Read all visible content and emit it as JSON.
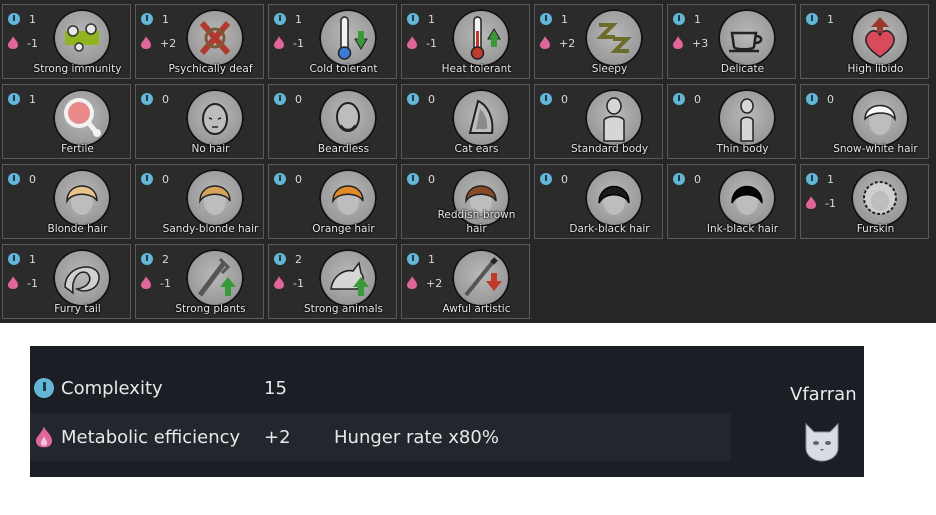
{
  "genes": [
    {
      "label": "Strong immunity",
      "complexity": "1",
      "metabolism": "-1",
      "icon": "immunity-icon"
    },
    {
      "label": "Psychically deaf",
      "complexity": "1",
      "metabolism": "+2",
      "icon": "psychic-deaf-icon"
    },
    {
      "label": "Cold tolerant",
      "complexity": "1",
      "metabolism": "-1",
      "icon": "cold-thermometer-icon"
    },
    {
      "label": "Heat tolerant",
      "complexity": "1",
      "metabolism": "-1",
      "icon": "heat-thermometer-icon"
    },
    {
      "label": "Sleepy",
      "complexity": "1",
      "metabolism": "+2",
      "icon": "sleepy-icon"
    },
    {
      "label": "Delicate",
      "complexity": "1",
      "metabolism": "+3",
      "icon": "teacup-icon"
    },
    {
      "label": "High libido",
      "complexity": "1",
      "metabolism": "",
      "icon": "heart-up-icon"
    },
    {
      "label": "Fertile",
      "complexity": "1",
      "metabolism": "",
      "icon": "fertile-icon"
    },
    {
      "label": "No hair",
      "complexity": "0",
      "metabolism": "",
      "icon": "bald-head-icon"
    },
    {
      "label": "Beardless",
      "complexity": "0",
      "metabolism": "",
      "icon": "beardless-icon"
    },
    {
      "label": "Cat ears",
      "complexity": "0",
      "metabolism": "",
      "icon": "cat-ear-icon"
    },
    {
      "label": "Standard body",
      "complexity": "0",
      "metabolism": "",
      "icon": "standard-body-icon"
    },
    {
      "label": "Thin body",
      "complexity": "0",
      "metabolism": "",
      "icon": "thin-body-icon"
    },
    {
      "label": "Snow-white hair",
      "complexity": "0",
      "metabolism": "",
      "icon": "white-hair-icon"
    },
    {
      "label": "Blonde hair",
      "complexity": "0",
      "metabolism": "",
      "icon": "blonde-hair-icon"
    },
    {
      "label": "Sandy-blonde hair",
      "complexity": "0",
      "metabolism": "",
      "icon": "sandy-hair-icon"
    },
    {
      "label": "Orange hair",
      "complexity": "0",
      "metabolism": "",
      "icon": "orange-hair-icon"
    },
    {
      "label": "Reddish-brown hair",
      "complexity": "0",
      "metabolism": "",
      "icon": "reddish-brown-hair-icon"
    },
    {
      "label": "Dark-black hair",
      "complexity": "0",
      "metabolism": "",
      "icon": "dark-black-hair-icon"
    },
    {
      "label": "Ink-black hair",
      "complexity": "0",
      "metabolism": "",
      "icon": "ink-black-hair-icon"
    },
    {
      "label": "Furskin",
      "complexity": "1",
      "metabolism": "-1",
      "icon": "furskin-icon"
    },
    {
      "label": "Furry tail",
      "complexity": "1",
      "metabolism": "-1",
      "icon": "furry-tail-icon"
    },
    {
      "label": "Strong plants",
      "complexity": "2",
      "metabolism": "-1",
      "icon": "plants-up-icon"
    },
    {
      "label": "Strong animals",
      "complexity": "2",
      "metabolism": "-1",
      "icon": "animals-up-icon"
    },
    {
      "label": "Awful artistic",
      "complexity": "1",
      "metabolism": "+2",
      "icon": "artistic-down-icon"
    }
  ],
  "summary": {
    "complexity_label": "Complexity",
    "complexity_value": "15",
    "metabolism_label": "Metabolic efficiency",
    "metabolism_value": "+2",
    "metabolism_effect": "Hunger rate x80%"
  },
  "xenotype": {
    "name": "Vfarran",
    "icon": "cat-head-icon"
  },
  "colors": {
    "complexity": "#63b6d6",
    "metabolism": "#e0669a",
    "up_arrow": "#4caf50",
    "down_arrow": "#c0392b"
  }
}
